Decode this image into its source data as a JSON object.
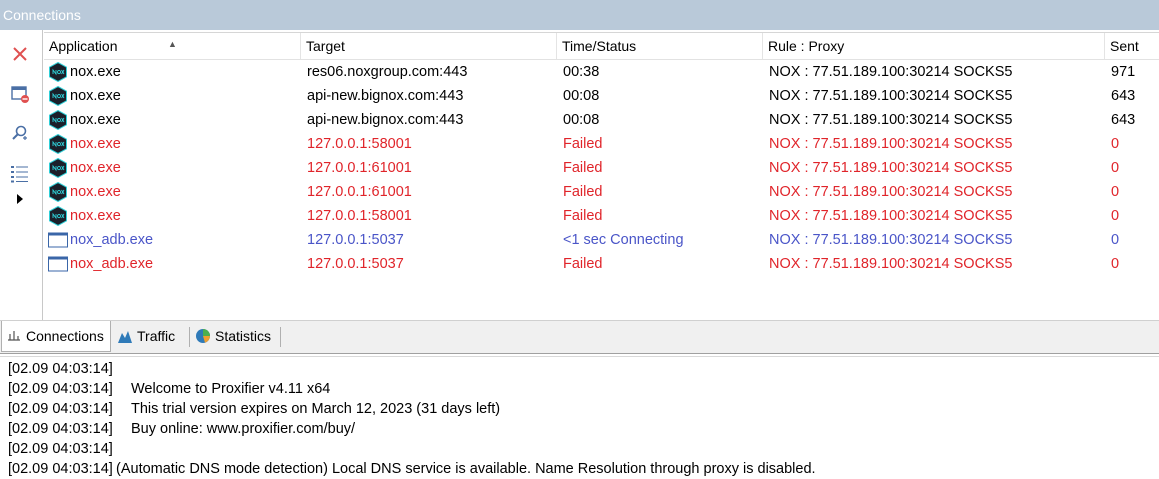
{
  "window": {
    "title": "Connections"
  },
  "toolbar": {
    "icons": [
      "close-connection-icon",
      "window-remove-icon",
      "find-icon",
      "view-list-icon",
      "expand-arrow-icon"
    ]
  },
  "table": {
    "columns": [
      "Application",
      "Target",
      "Time/Status",
      "Rule : Proxy",
      "Sent"
    ],
    "rows": [
      {
        "app": "nox.exe",
        "target": "res06.noxgroup.com:443",
        "status": "00:38",
        "rule": "NOX : 77.51.189.100:30214 SOCKS5",
        "sent": "971",
        "state": "ok",
        "icon": "nox"
      },
      {
        "app": "nox.exe",
        "target": "api-new.bignox.com:443",
        "status": "00:08",
        "rule": "NOX : 77.51.189.100:30214 SOCKS5",
        "sent": "643",
        "state": "ok",
        "icon": "nox"
      },
      {
        "app": "nox.exe",
        "target": "api-new.bignox.com:443",
        "status": "00:08",
        "rule": "NOX : 77.51.189.100:30214 SOCKS5",
        "sent": "643",
        "state": "ok",
        "icon": "nox"
      },
      {
        "app": "nox.exe",
        "target": "127.0.0.1:58001",
        "status": "Failed",
        "rule": "NOX : 77.51.189.100:30214 SOCKS5",
        "sent": "0",
        "state": "fail",
        "icon": "nox"
      },
      {
        "app": "nox.exe",
        "target": "127.0.0.1:61001",
        "status": "Failed",
        "rule": "NOX : 77.51.189.100:30214 SOCKS5",
        "sent": "0",
        "state": "fail",
        "icon": "nox"
      },
      {
        "app": "nox.exe",
        "target": "127.0.0.1:61001",
        "status": "Failed",
        "rule": "NOX : 77.51.189.100:30214 SOCKS5",
        "sent": "0",
        "state": "fail",
        "icon": "nox"
      },
      {
        "app": "nox.exe",
        "target": "127.0.0.1:58001",
        "status": "Failed",
        "rule": "NOX : 77.51.189.100:30214 SOCKS5",
        "sent": "0",
        "state": "fail",
        "icon": "nox"
      },
      {
        "app": "nox_adb.exe",
        "target": "127.0.0.1:5037",
        "status": "<1 sec Connecting",
        "rule": "NOX : 77.51.189.100:30214 SOCKS5",
        "sent": "0",
        "state": "conn",
        "icon": "window"
      },
      {
        "app": "nox_adb.exe",
        "target": "127.0.0.1:5037",
        "status": "Failed",
        "rule": "NOX : 77.51.189.100:30214 SOCKS5",
        "sent": "0",
        "state": "fail",
        "icon": "window"
      }
    ]
  },
  "tabs": [
    {
      "label": "Connections",
      "icon": "connections-icon",
      "active": true
    },
    {
      "label": "Traffic",
      "icon": "traffic-chart-icon",
      "active": false
    },
    {
      "label": "Statistics",
      "icon": "statistics-pie-icon",
      "active": false
    }
  ],
  "log": [
    {
      "time": "[02.09 04:03:14]",
      "msg": ""
    },
    {
      "time": "[02.09 04:03:14]",
      "msg": "Welcome to Proxifier v4.11 x64"
    },
    {
      "time": "[02.09 04:03:14]",
      "msg": "This trial version expires on March 12, 2023 (31 days left)"
    },
    {
      "time": "[02.09 04:03:14]",
      "msg": "Buy online: www.proxifier.com/buy/"
    },
    {
      "time": "[02.09 04:03:14]",
      "msg": ""
    },
    {
      "time": "[02.09 04:03:14]",
      "msg": "(Automatic DNS mode detection) Local DNS service is available. Name Resolution through proxy is disabled."
    }
  ],
  "colors": {
    "failed": "#e0242a",
    "connecting": "#4a55c8",
    "titlebar": "#b9c9d9"
  }
}
